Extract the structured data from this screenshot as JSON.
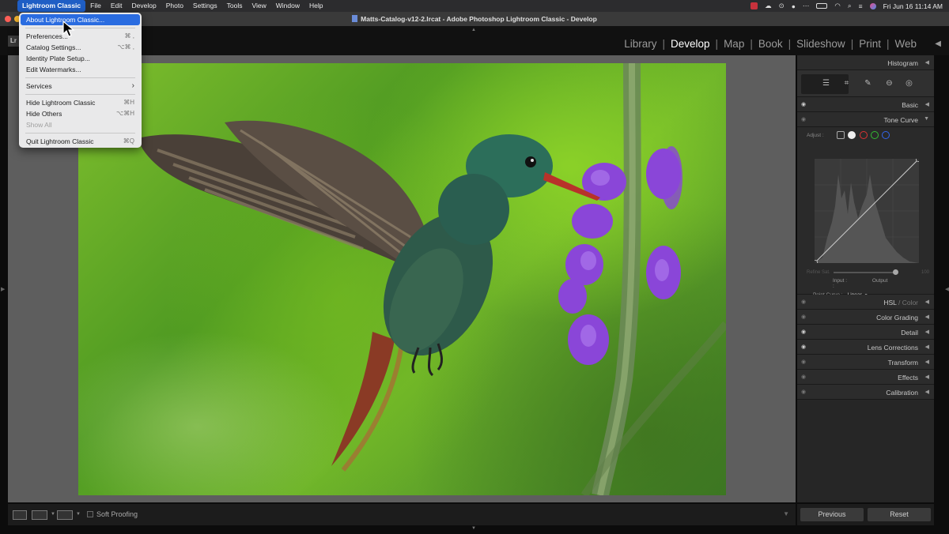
{
  "menubar": {
    "app_menu": "Lightroom Classic",
    "items": [
      "File",
      "Edit",
      "Develop",
      "Photo",
      "Settings",
      "Tools",
      "View",
      "Window",
      "Help"
    ],
    "datetime": "Fri Jun 16  11:14 AM"
  },
  "window": {
    "title": "Matts-Catalog-v12-2.lrcat - Adobe Photoshop Lightroom Classic - Develop"
  },
  "app_menu_dropdown": {
    "items": [
      {
        "label": "About Lightroom Classic...",
        "shortcut": ""
      },
      {
        "label": "Preferences...",
        "shortcut": "⌘ ,"
      },
      {
        "label": "Catalog Settings...",
        "shortcut": "⌥⌘ ,"
      },
      {
        "label": "Identity Plate Setup...",
        "shortcut": ""
      },
      {
        "label": "Edit Watermarks...",
        "shortcut": ""
      },
      {
        "label": "Services",
        "shortcut": "›"
      },
      {
        "label": "Hide Lightroom Classic",
        "shortcut": "⌘H"
      },
      {
        "label": "Hide Others",
        "shortcut": "⌥⌘H"
      },
      {
        "label": "Show All",
        "shortcut": ""
      },
      {
        "label": "Quit Lightroom Classic",
        "shortcut": "⌘Q"
      }
    ]
  },
  "modules": {
    "logo": "Lr",
    "items": [
      "Library",
      "Develop",
      "Map",
      "Book",
      "Slideshow",
      "Print",
      "Web"
    ],
    "active": "Develop"
  },
  "right_panel": {
    "histogram": "Histogram",
    "basic": "Basic",
    "tone_curve": {
      "title": "Tone Curve",
      "adjust_label": "Adjust :",
      "refine_label": "Refine Sat.",
      "refine_value": "100",
      "input_label": "Input :",
      "output_label": "Output :",
      "point_curve_label": "Point Curve :",
      "point_curve_value": "Linear"
    },
    "hsl": "HSL",
    "color": "Color",
    "sections": [
      "Color Grading",
      "Detail",
      "Lens Corrections",
      "Transform",
      "Effects",
      "Calibration"
    ],
    "previous_button": "Previous",
    "reset_button": "Reset"
  },
  "toolbar": {
    "soft_proofing": "Soft Proofing"
  },
  "colors": {
    "accent": "#2a6ce0",
    "panel_bg": "#262626",
    "canvas_bg": "#5e5e5e"
  }
}
